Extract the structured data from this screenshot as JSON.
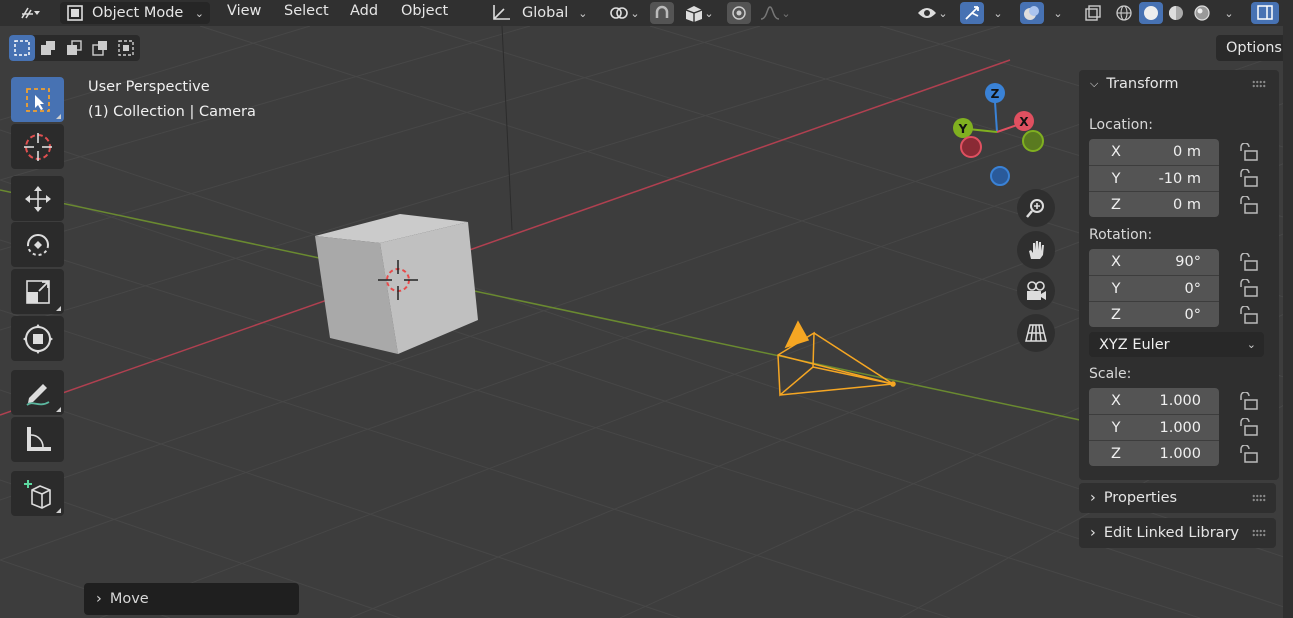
{
  "header": {
    "mode_label": "Object Mode",
    "menus": [
      "View",
      "Select",
      "Add",
      "Object"
    ],
    "transform_orientation": "Global"
  },
  "options_label": "Options",
  "viewport": {
    "view_name": "User Perspective",
    "collection_info": "(1) Collection | Camera"
  },
  "gizmo": {
    "z": "Z",
    "y": "Y",
    "x": "X"
  },
  "sidebar": {
    "transform_title": "Transform",
    "location_label": "Location:",
    "location": [
      {
        "axis": "X",
        "value": "0 m"
      },
      {
        "axis": "Y",
        "value": "-10 m"
      },
      {
        "axis": "Z",
        "value": "0 m"
      }
    ],
    "rotation_label": "Rotation:",
    "rotation": [
      {
        "axis": "X",
        "value": "90°"
      },
      {
        "axis": "Y",
        "value": "0°"
      },
      {
        "axis": "Z",
        "value": "0°"
      }
    ],
    "rotation_mode": "XYZ Euler",
    "scale_label": "Scale:",
    "scale": [
      {
        "axis": "X",
        "value": "1.000"
      },
      {
        "axis": "Y",
        "value": "1.000"
      },
      {
        "axis": "Z",
        "value": "1.000"
      }
    ],
    "properties_title": "Properties",
    "edit_linked_library_title": "Edit Linked Library"
  },
  "last_operator": "Move",
  "colors": {
    "accent": "#4772b3",
    "x_axis": "#e05060",
    "y_axis": "#80b020",
    "z_axis": "#3a82d6",
    "selection": "#f5a623"
  }
}
